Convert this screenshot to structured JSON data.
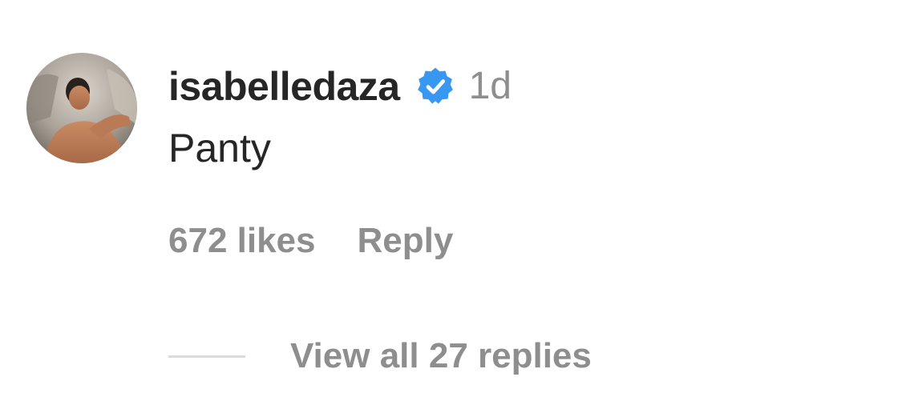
{
  "comment": {
    "author": {
      "username": "isabelledaza",
      "verified": true,
      "avatar": "profile-photo"
    },
    "timestamp": "1d",
    "text": "Panty",
    "likes_label": "672 likes",
    "reply_label": "Reply",
    "view_replies_label": "View all 27 replies"
  },
  "colors": {
    "text_primary": "#262626",
    "text_secondary": "#8e8e8e",
    "verified_blue": "#3897f0",
    "divider": "#dbdbdb"
  }
}
